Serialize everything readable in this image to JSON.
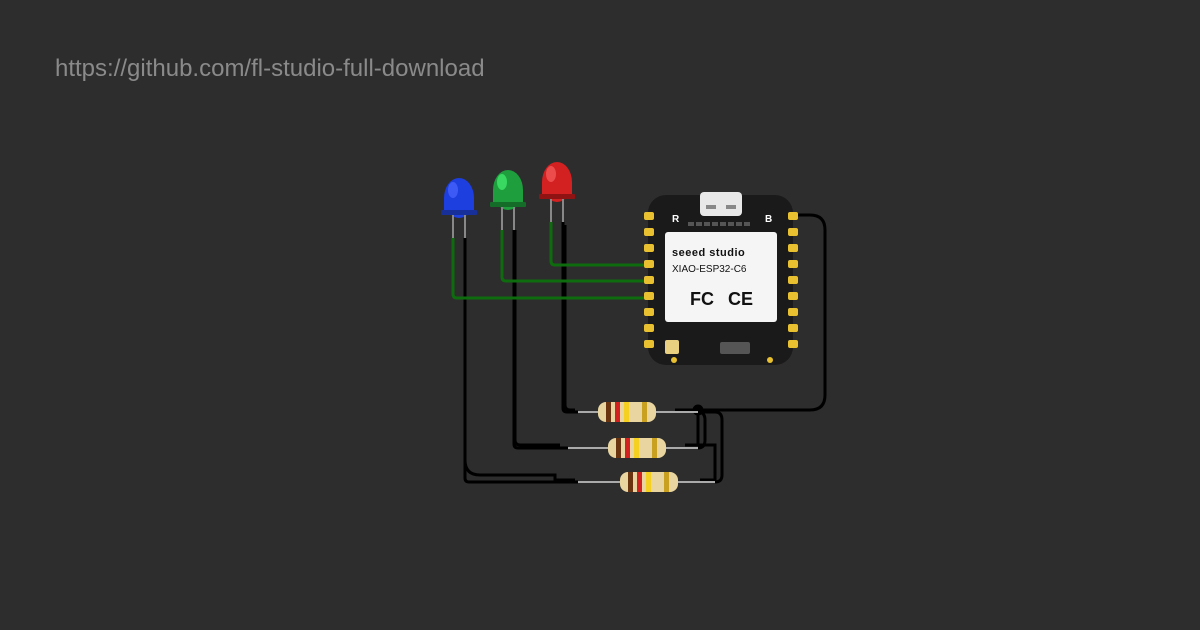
{
  "url": "https://github.com/fl-studio-full-download",
  "board": {
    "brand": "seeed studio",
    "model": "XIAO-ESP32-C6",
    "label_R": "R",
    "label_B": "B",
    "cert_fcc": "FC",
    "cert_ce": "CE"
  },
  "leds": [
    {
      "color": "#1e3fe0",
      "name": "blue-led"
    },
    {
      "color": "#1e9e3c",
      "name": "green-led"
    },
    {
      "color": "#d32020",
      "name": "red-led"
    }
  ],
  "resistors": {
    "count": 3
  },
  "wires": {
    "signal_color": "#0e6b0e",
    "ground_color": "#000000"
  }
}
